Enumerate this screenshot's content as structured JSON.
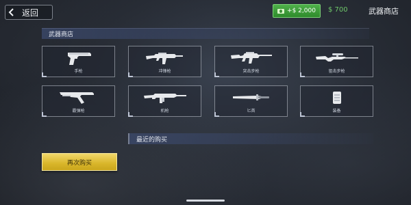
{
  "header": {
    "back_label": "返回",
    "topup_label": "+$ 2,000",
    "balance": "$ 700",
    "title": "武器商店"
  },
  "shop": {
    "section_title": "武器商店",
    "items": [
      {
        "name": "手枪",
        "icon": "pistol-icon"
      },
      {
        "name": "冲锋枪",
        "icon": "smg-icon"
      },
      {
        "name": "突击步枪",
        "icon": "assault-rifle-icon"
      },
      {
        "name": "狙击步枪",
        "icon": "sniper-rifle-icon"
      },
      {
        "name": "霰弹枪",
        "icon": "shotgun-icon"
      },
      {
        "name": "机枪",
        "icon": "machine-gun-icon"
      },
      {
        "name": "匕首",
        "icon": "knife-icon"
      },
      {
        "name": "装备",
        "icon": "armor-icon"
      }
    ]
  },
  "recent": {
    "title": "最近的购买"
  },
  "rebuy_label": "再次购买",
  "colors": {
    "accent_green": "#4fb04a",
    "balance_green": "#6fc86a",
    "gold": "#d9b62a"
  }
}
